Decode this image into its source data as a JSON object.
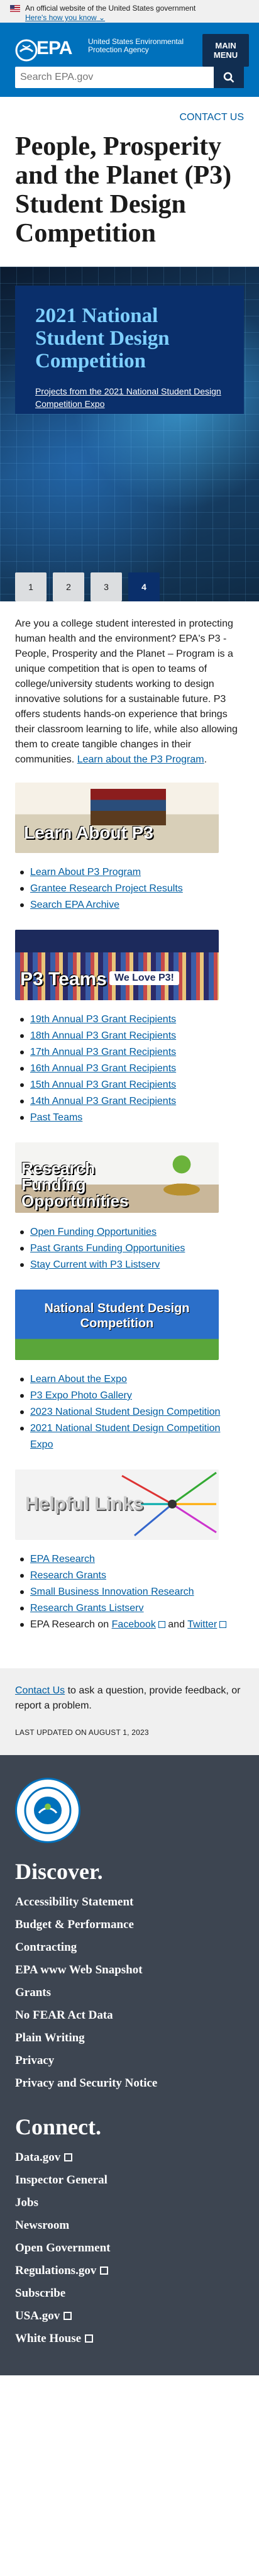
{
  "gov_banner": {
    "text": "An official website of the United States government",
    "link": "Here's how you know"
  },
  "header": {
    "logo_text": "EPA",
    "agency_name": "United States Environmental Protection Agency",
    "menu_label": "MAIN\nMENU"
  },
  "search": {
    "placeholder": "Search EPA.gov"
  },
  "contact_link": "CONTACT US",
  "page_title": "People, Prosperity and the Planet (P3) Student Design Competition",
  "carousel": {
    "heading": "2021 National Student Design Competition",
    "link": "Projects from the 2021 National Student Design Competition Expo",
    "pages": [
      "1",
      "2",
      "3",
      "4"
    ],
    "active_page": "4"
  },
  "intro": {
    "text": "Are you a college student interested in protecting human health and the environment? EPA's P3 - People, Prosperity and the Planet – Program is a unique competition that is open to teams of college/university students working to design innovative solutions for a sustainable future. P3 offers students hands-on experience that brings their classroom learning to life, while also allowing them to create tangible changes in their communities.",
    "link": "Learn about the P3 Program"
  },
  "sections": [
    {
      "banner": "Learn About P3",
      "links": [
        "Learn About P3 Program",
        "Grantee Research Project Results",
        "Search EPA Archive"
      ]
    },
    {
      "banner": "P3 Teams",
      "banner_sub": "We Love P3!",
      "links": [
        "19th Annual P3 Grant Recipients",
        "18th Annual P3 Grant Recipients",
        "17th Annual P3 Grant Recipients",
        "16th Annual P3 Grant Recipients",
        "15th Annual P3 Grant Recipients",
        "14th Annual P3 Grant Recipients",
        "Past Teams"
      ]
    },
    {
      "banner": "Research Funding Opportunities",
      "links": [
        "Open Funding Opportunities",
        "Past Grants Funding Opportunities",
        "Stay Current with P3 Listserv"
      ]
    },
    {
      "banner": "National Student Design Competition",
      "links": [
        "Learn About the Expo",
        "P3 Expo Photo Gallery",
        "2023 National Student Design Competition",
        "2021 National Student Design Competition Expo"
      ]
    },
    {
      "banner": "Helpful Links",
      "links": [
        "EPA Research",
        "Research Grants",
        "Small Business Innovation Research",
        "Research Grants Listserv"
      ],
      "social": {
        "prefix": "EPA Research on",
        "facebook": "Facebook",
        "and": "and",
        "twitter": "Twitter"
      }
    }
  ],
  "note": {
    "contact": "Contact Us",
    "text": "to ask a question, provide feedback, or report a problem.",
    "updated": "LAST UPDATED ON AUGUST 1, 2023"
  },
  "footer": {
    "discover_title": "Discover.",
    "discover": [
      "Accessibility Statement",
      "Budget & Performance",
      "Contracting",
      "EPA www Web Snapshot",
      "Grants",
      "No FEAR Act Data",
      "Plain Writing",
      "Privacy",
      "Privacy and Security Notice"
    ],
    "connect_title": "Connect.",
    "connect": [
      {
        "label": "Data.gov",
        "ext": true
      },
      {
        "label": "Inspector General",
        "ext": false
      },
      {
        "label": "Jobs",
        "ext": false
      },
      {
        "label": "Newsroom",
        "ext": false
      },
      {
        "label": "Open Government",
        "ext": false
      },
      {
        "label": "Regulations.gov",
        "ext": true
      },
      {
        "label": "Subscribe",
        "ext": false
      },
      {
        "label": "USA.gov",
        "ext": true
      },
      {
        "label": "White House",
        "ext": true
      }
    ]
  }
}
